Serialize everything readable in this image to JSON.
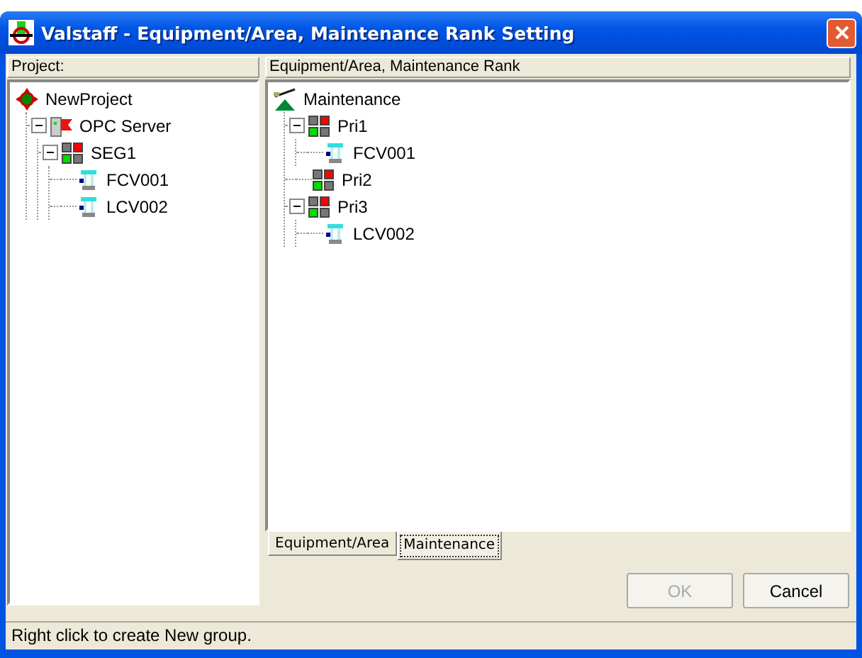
{
  "window": {
    "title": "Valstaff - Equipment/Area, Maintenance Rank Setting"
  },
  "project_panel": {
    "header": "Project:",
    "tree": [
      {
        "label": "NewProject",
        "kind": "project",
        "children": [
          {
            "label": "OPC Server",
            "kind": "server",
            "expanded": true,
            "children": [
              {
                "label": "SEG1",
                "kind": "group",
                "expanded": true,
                "children": [
                  {
                    "label": "FCV001",
                    "kind": "valve"
                  },
                  {
                    "label": "LCV002",
                    "kind": "valve"
                  }
                ]
              }
            ]
          }
        ]
      }
    ]
  },
  "rank_panel": {
    "header": "Equipment/Area, Maintenance Rank",
    "tree": [
      {
        "label": "Maintenance",
        "kind": "maintenance",
        "children": [
          {
            "label": "Pri1",
            "kind": "group",
            "expanded": true,
            "children": [
              {
                "label": "FCV001",
                "kind": "valve"
              }
            ]
          },
          {
            "label": "Pri2",
            "kind": "group"
          },
          {
            "label": "Pri3",
            "kind": "group",
            "expanded": true,
            "children": [
              {
                "label": "LCV002",
                "kind": "valve"
              }
            ]
          }
        ]
      }
    ]
  },
  "tabs": [
    {
      "label": "Equipment/Area",
      "selected": false
    },
    {
      "label": "Maintenance",
      "selected": true
    }
  ],
  "buttons": [
    {
      "label": "OK",
      "disabled": true
    },
    {
      "label": "Cancel",
      "disabled": false
    }
  ],
  "status_bar": "Right click to create New group."
}
